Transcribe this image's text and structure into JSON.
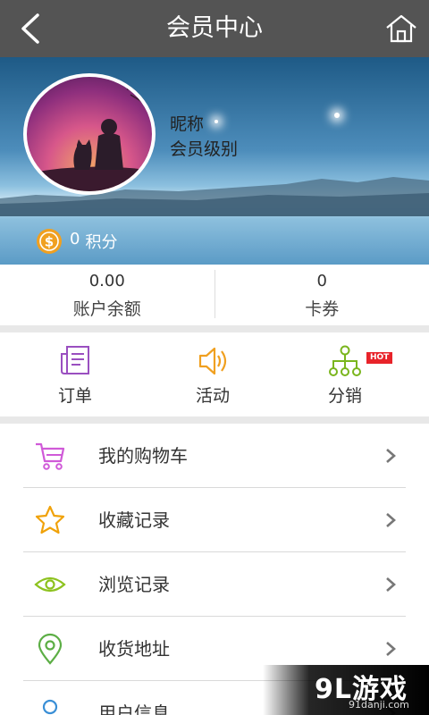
{
  "header": {
    "title": "会员中心"
  },
  "profile": {
    "nickname": "昵称",
    "level": "会员级别",
    "points_value": "0",
    "points_label": "积分"
  },
  "stats": [
    {
      "value": "0.00",
      "label": "账户余额"
    },
    {
      "value": "0",
      "label": "卡券"
    }
  ],
  "quick_actions": [
    {
      "label": "订单",
      "icon": "order-icon"
    },
    {
      "label": "活动",
      "icon": "speaker-icon"
    },
    {
      "label": "分销",
      "icon": "distribution-icon",
      "badge": "HOT"
    }
  ],
  "menu": [
    {
      "label": "我的购物车",
      "icon": "cart-icon",
      "color": "#d05ad8"
    },
    {
      "label": "收藏记录",
      "icon": "star-icon",
      "color": "#f0a20a"
    },
    {
      "label": "浏览记录",
      "icon": "eye-icon",
      "color": "#8dc21f"
    },
    {
      "label": "收货地址",
      "icon": "location-pin-icon",
      "color": "#5cae45"
    },
    {
      "label": "用户信息",
      "icon": "user-icon",
      "color": "#3a8fd6"
    }
  ],
  "watermark": {
    "brand": "9L游戏",
    "domain": "91danji.com"
  },
  "colors": {
    "header_bg": "#545454",
    "hot_badge": "#e8232a",
    "coin": "#f0a020"
  }
}
